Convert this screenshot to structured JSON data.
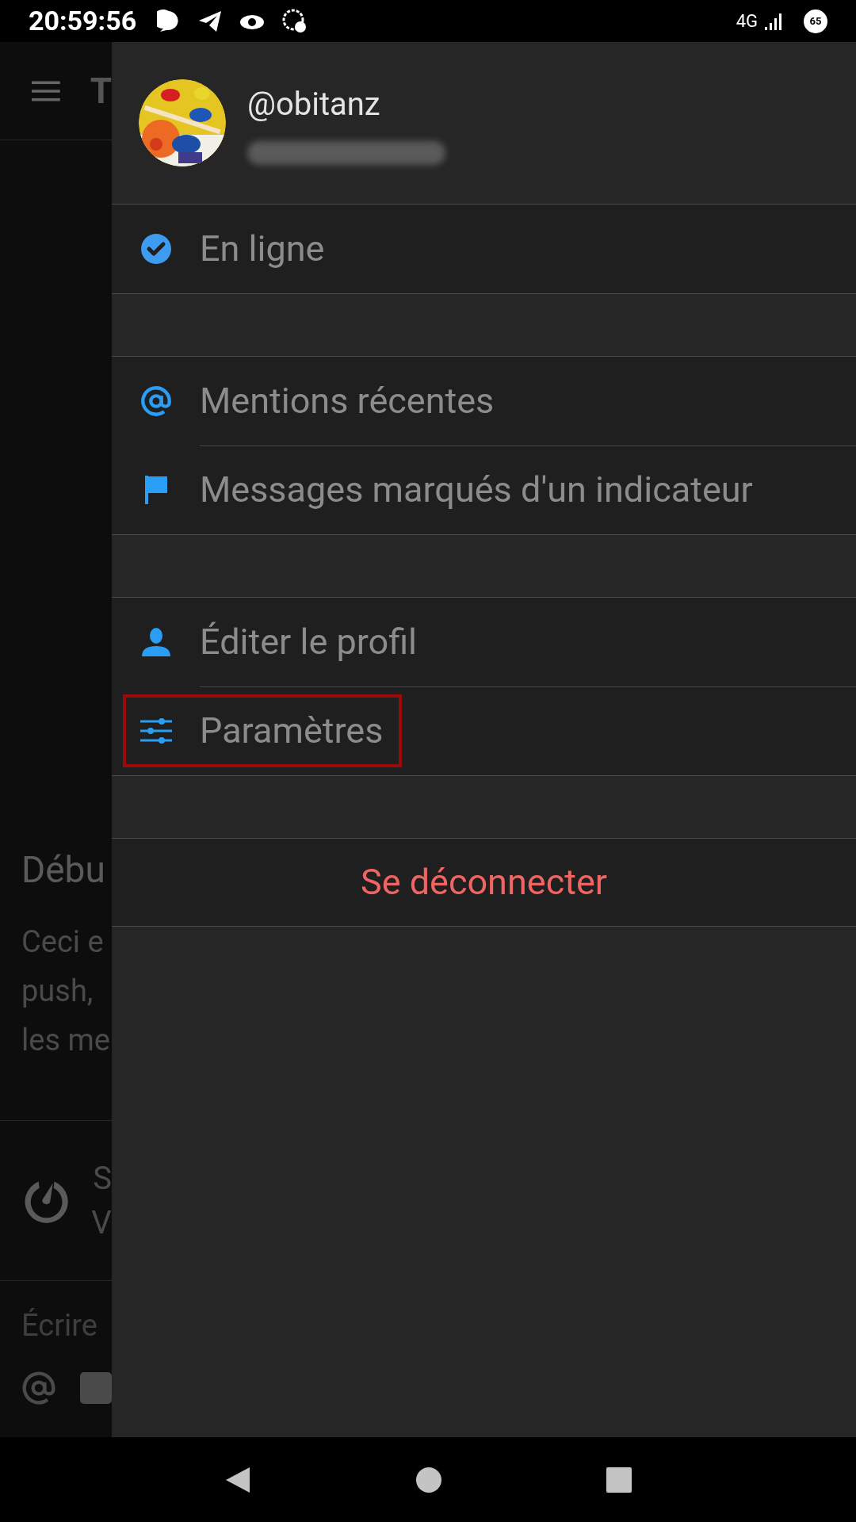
{
  "status_bar": {
    "time": "20:59:56",
    "network": "4G",
    "battery": "65"
  },
  "background": {
    "header_title": "T",
    "heading": "Débu",
    "body_lines": [
      "Ceci e",
      "push,",
      "les me"
    ],
    "banner_lines": [
      "S",
      "V"
    ],
    "input_placeholder": "Écrire"
  },
  "drawer": {
    "username": "@obitanz",
    "menu_groups": [
      [
        {
          "label": "En ligne",
          "highlighted": false
        }
      ],
      [
        {
          "label": "Mentions récentes",
          "highlighted": false
        },
        {
          "label": "Messages marqués d'un indicateur",
          "highlighted": false
        }
      ],
      [
        {
          "label": "Éditer le profil",
          "highlighted": false
        },
        {
          "label": "Paramètres",
          "highlighted": true
        }
      ]
    ],
    "logout": {
      "label": "Se déconnecter"
    }
  }
}
